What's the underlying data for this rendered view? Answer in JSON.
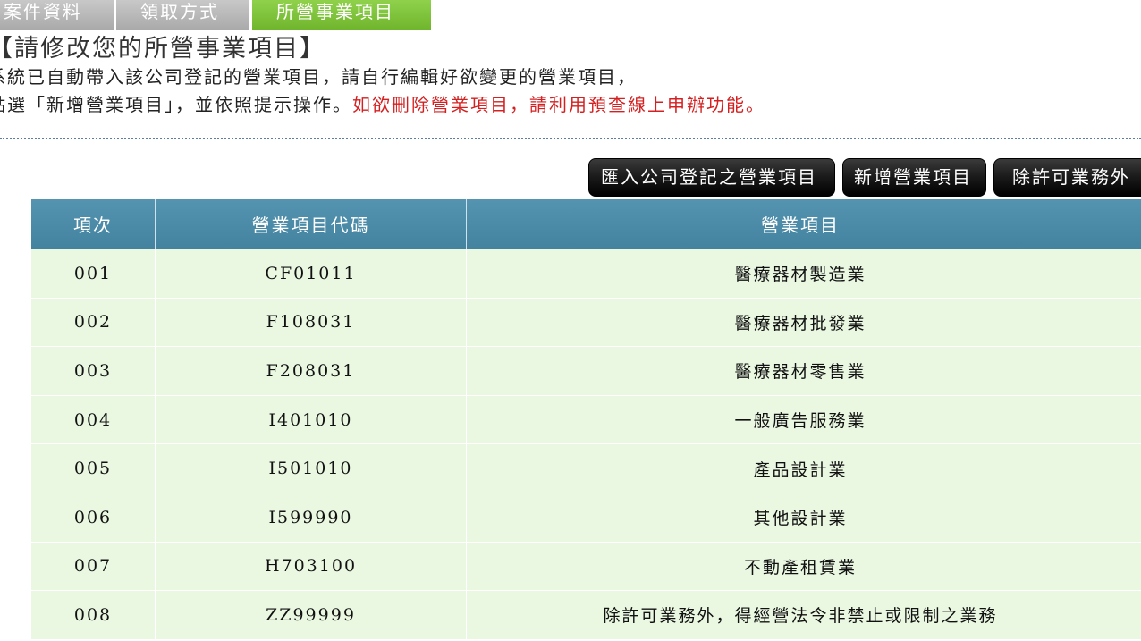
{
  "tabs": [
    {
      "label": "案件資料"
    },
    {
      "label": "領取方式"
    },
    {
      "label": "所營事業項目"
    }
  ],
  "heading": "【請修改您的所營事業項目】",
  "instructions": {
    "line1": "系統已自動帶入該公司登記的營業項目，請自行編輯好欲變更的營業項目，",
    "line2_prefix": "點選「新增營業項目」，並依照提示操作。",
    "line2_warning": "如欲刪除營業項目，請利用預查線上申辦功能。"
  },
  "buttons": {
    "import": "匯入公司登記之營業項目",
    "add": "新增營業項目",
    "exempt": "除許可業務外"
  },
  "table": {
    "headers": [
      "項次",
      "營業項目代碼",
      "營業項目"
    ],
    "rows": [
      {
        "no": "001",
        "code": "CF01011",
        "item": "醫療器材製造業"
      },
      {
        "no": "002",
        "code": "F108031",
        "item": "醫療器材批發業"
      },
      {
        "no": "003",
        "code": "F208031",
        "item": "醫療器材零售業"
      },
      {
        "no": "004",
        "code": "I401010",
        "item": "一般廣告服務業"
      },
      {
        "no": "005",
        "code": "I501010",
        "item": "產品設計業"
      },
      {
        "no": "006",
        "code": "I599990",
        "item": "其他設計業"
      },
      {
        "no": "007",
        "code": "H703100",
        "item": "不動產租賃業"
      },
      {
        "no": "008",
        "code": "ZZ99999",
        "item": "除許可業務外，得經營法令非禁止或限制之業務"
      }
    ]
  },
  "colors": {
    "tab_active": "#7cc13a",
    "tab_inactive": "#b8b8b8",
    "table_header": "#4a8aa6",
    "row_bg": "#eaf8e2",
    "warning_text": "#d42020"
  }
}
